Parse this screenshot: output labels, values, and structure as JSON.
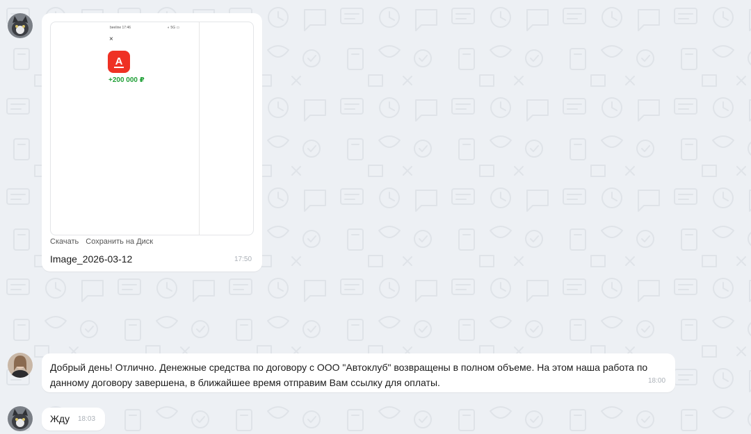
{
  "messages": [
    {
      "type": "image",
      "preview": {
        "status_bar_text": "beeline 17:46",
        "status_icons": "◐ 5G ▭",
        "close_glyph": "×",
        "bank_logo_letter": "А",
        "amount": "+200 000 ₽"
      },
      "actions": {
        "download_label": "Скачать",
        "save_to_disk_label": "Сохранить на Диск"
      },
      "filename": "Image_2026-03-12",
      "time": "17:50"
    },
    {
      "type": "text",
      "text": "Добрый день! Отлично. Денежные средства по договору с ООО \"Автоклуб\" возвращены в полном объеме. На этом наша работа по данному договору завершена, в ближайшее время отправим Вам ссылку для оплаты.",
      "time": "18:00"
    },
    {
      "type": "text",
      "text": "Жду",
      "time": "18:03"
    }
  ],
  "colors": {
    "background": "#edf0f4",
    "bubble": "#ffffff",
    "bank_red": "#ef3124",
    "amount_green": "#21a038",
    "timestamp": "#aab0b7"
  },
  "icons": {
    "avatar_1": "cat-avatar",
    "avatar_2": "person-avatar",
    "bank_logo": "alfa-bank-logo-icon",
    "close": "close-icon"
  }
}
